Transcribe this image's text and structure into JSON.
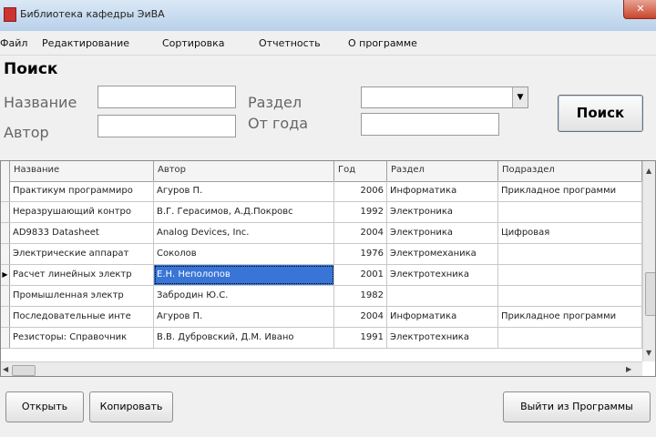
{
  "window": {
    "title": "Библиотека кафедры ЭиВА",
    "close_glyph": "✕"
  },
  "menu": [
    "Файл",
    "Редактирование",
    "Сортировка",
    "Отчетность",
    "О программе"
  ],
  "search": {
    "heading": "Поиск",
    "name_label": "Название",
    "author_label": "Автор",
    "section_label": "Раздел",
    "year_label": "От года",
    "name_value": "",
    "author_value": "",
    "section_value": "",
    "year_value": "",
    "button_label": "Поиск"
  },
  "table": {
    "columns": [
      "Название",
      "Автор",
      "Год",
      "Раздел",
      "Подраздел"
    ],
    "rows": [
      [
        "Практикум программиро",
        "Агуров П.",
        "2006",
        "Информатика",
        "Прикладное программи"
      ],
      [
        "Неразрушающий контро",
        "В.Г. Герасимов, А.Д.Покровс",
        "1992",
        "Электроника",
        ""
      ],
      [
        "AD9833 Datasheet",
        "Analog Devices, Inc.",
        "2004",
        "Электроника",
        "Цифровая"
      ],
      [
        "Электрические аппарат",
        "Соколов",
        "1976",
        "Электромеханика",
        ""
      ],
      [
        "Расчет линейных электр",
        "Е.Н. Неполопов",
        "2001",
        "Электротехника",
        ""
      ],
      [
        "Промышленная электр",
        "Забродин Ю.С.",
        "1982",
        "",
        ""
      ],
      [
        "Последовательные инте",
        "Агуров П.",
        "2004",
        "Информатика",
        "Прикладное программи"
      ],
      [
        "Резисторы: Справочник",
        "В.В. Дубровский, Д.М. Ивано",
        "1991",
        "Электротехника",
        ""
      ]
    ],
    "current_row_marker": "▶"
  },
  "buttons": {
    "open": "Открыть",
    "copy": "Копировать",
    "exit": "Выйти из Программы"
  },
  "scroll": {
    "up": "▲",
    "down": "▼",
    "left": "◀",
    "right": "▶"
  },
  "colors": {
    "selection": "#3875d7",
    "title_bar": "#b9d1ea"
  }
}
